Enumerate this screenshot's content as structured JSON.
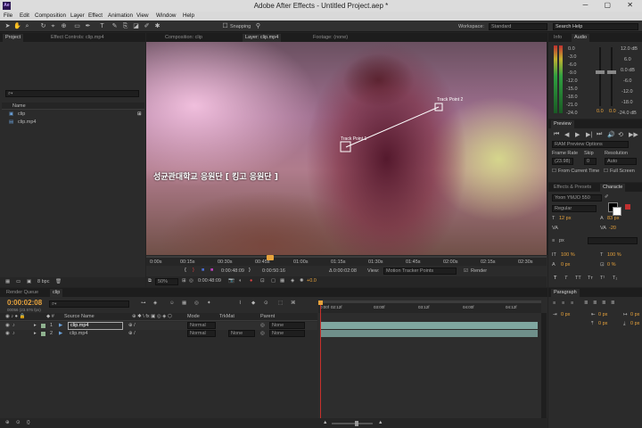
{
  "window": {
    "title": "Adobe After Effects - Untitled Project.aep *",
    "logo": "Ae"
  },
  "menu": [
    "File",
    "Edit",
    "Composition",
    "Layer",
    "Effect",
    "Animation",
    "View",
    "Window",
    "Help"
  ],
  "toolbar": {
    "snapping_label": "Snapping",
    "workspace_label": "Workspace:",
    "workspace_value": "Standard",
    "search_placeholder": "Search Help"
  },
  "project_panel": {
    "tabs": [
      "Project",
      "Effect Controls: clip.mp4"
    ],
    "search_placeholder": "",
    "column_name": "Name",
    "items": [
      {
        "name": "clip",
        "kind": "composition"
      },
      {
        "name": "clip.mp4",
        "kind": "footage"
      }
    ],
    "bpc": "8 bpc"
  },
  "viewer": {
    "tabs": [
      "Composition: clip",
      "Layer: clip.mp4",
      "Footage: (none)"
    ],
    "subtitle": "성균관대학교 응원단 [ 킹고 응원단 ]",
    "track_point_1": "Track Point 1",
    "track_point_2": "Track Point 2",
    "ruler_labels": [
      "0:00s",
      "00:15s",
      "00:30s",
      "00:45s",
      "01:00s",
      "01:15s",
      "01:30s",
      "01:45s",
      "02:00s",
      "02:15s",
      "02:30s"
    ],
    "footer_row1": {
      "in": "0:00:48:09",
      "out": "0:00:50:16",
      "delta": "Δ 0:00:02:08",
      "view_label": "View:",
      "view_value": "Motion Tracker Points",
      "render_label": "Render"
    },
    "footer_row2": {
      "zoom": "50%",
      "timecode": "0:00:48:09",
      "exposure": "+0.0"
    }
  },
  "info_panel": {
    "tabs": [
      "Info",
      "Audio"
    ],
    "left_scale": [
      "0.0",
      "-3.0",
      "-6.0",
      "-9.0",
      "-12.0",
      "-15.0",
      "-18.0",
      "-21.0",
      "-24.0"
    ],
    "right_scale": [
      "12.0 dB",
      "6.0",
      "0.0 dB",
      "-6.0",
      "-12.0",
      "-18.0",
      "-24.0 dB"
    ],
    "level_left": "0.0",
    "level_right": "0.0"
  },
  "preview_panel": {
    "title": "Preview",
    "ram_options": "RAM Preview Options",
    "labels": {
      "frame_rate": "Frame Rate",
      "skip": "Skip",
      "resolution": "Resolution"
    },
    "values": {
      "frame_rate": "(23.98)",
      "skip": "0",
      "resolution": "Auto"
    },
    "from_current": "From Current Time",
    "full_screen": "Full Screen"
  },
  "effects_panel": {
    "tabs": [
      "Effects & Presets",
      "Characte"
    ],
    "font": "Yoon YMJO 550",
    "style": "Regular",
    "size": "12 px",
    "leading": "83 px",
    "tracking": "-20",
    "kerning": "",
    "unit": "px",
    "scale_v": "100 %",
    "scale_h": "100 %",
    "baseline": "0 px",
    "tsume": "0 %"
  },
  "paragraph_panel": {
    "title": "Paragraph",
    "values": [
      "0 px",
      "0 px",
      "0 px",
      "0 px",
      "0 px"
    ]
  },
  "timeline": {
    "tabs": [
      "Render Queue",
      "clip"
    ],
    "timecode": "0:00:02:08",
    "fps_label": "00056 (23.976 fps)",
    "columns": {
      "source_name": "Source Name",
      "mode": "Mode",
      "trkmat": "TrkMat",
      "parent": "Parent"
    },
    "ruler": [
      "0:00f",
      "02:12f",
      "03:00f",
      "03:12f",
      "04:00f",
      "04:12f"
    ],
    "layers": [
      {
        "index": "1",
        "name": "clip.mp4",
        "mode": "Normal",
        "trkmat": "",
        "parent": "None",
        "color": "#8fb28f"
      },
      {
        "index": "2",
        "name": "clip.mp4",
        "mode": "Normal",
        "trkmat": "None",
        "parent": "None",
        "color": "#8fb28f"
      }
    ]
  },
  "colors": {
    "accent": "#e8a33c",
    "track_bar": "#7fa6a0",
    "playhead": "#c8302c"
  }
}
